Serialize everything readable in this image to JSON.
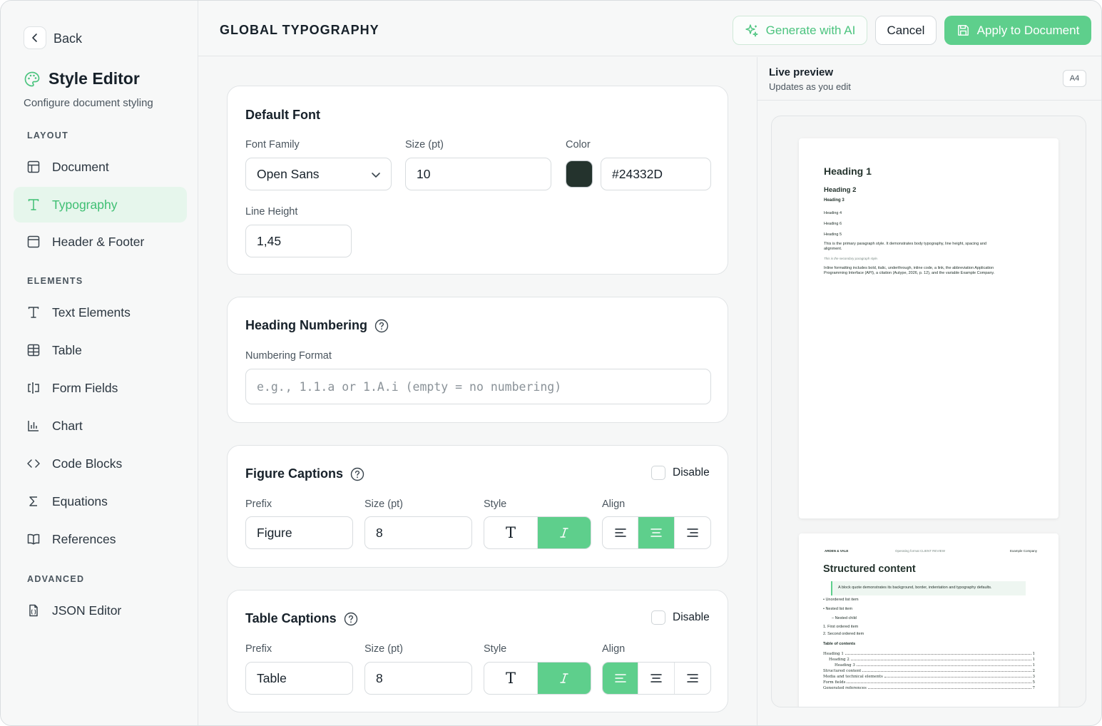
{
  "sidebar": {
    "back_label": "Back",
    "title": "Style Editor",
    "subtitle": "Configure document styling",
    "sections": {
      "layout": "LAYOUT",
      "elements": "ELEMENTS",
      "advanced": "ADVANCED"
    },
    "items": [
      {
        "label": "Document",
        "icon": "layout-icon"
      },
      {
        "label": "Typography",
        "icon": "type-icon",
        "active": true
      },
      {
        "label": "Header & Footer",
        "icon": "panel-icon"
      },
      {
        "label": "Text Elements",
        "icon": "type-icon"
      },
      {
        "label": "Table",
        "icon": "table-icon"
      },
      {
        "label": "Form Fields",
        "icon": "form-input-icon"
      },
      {
        "label": "Chart",
        "icon": "bar-chart-icon"
      },
      {
        "label": "Code Blocks",
        "icon": "code-icon"
      },
      {
        "label": "Equations",
        "icon": "sigma-icon"
      },
      {
        "label": "References",
        "icon": "book-open-icon"
      },
      {
        "label": "JSON Editor",
        "icon": "file-json-icon"
      }
    ],
    "accent": "#3fbf73"
  },
  "toolbar": {
    "title": "GLOBAL TYPOGRAPHY",
    "generate_label": "Generate with AI",
    "cancel_label": "Cancel",
    "apply_label": "Apply to Document",
    "apply_color": "#5ecf8c"
  },
  "default_font": {
    "title": "Default Font",
    "family_label": "Font Family",
    "family_value": "Open Sans",
    "size_label": "Size (pt)",
    "size_value": "10",
    "color_label": "Color",
    "color_value": "#24332D",
    "line_height_label": "Line Height",
    "line_height_value": "1,45"
  },
  "heading_numbering": {
    "title": "Heading Numbering",
    "format_label": "Numbering Format",
    "format_placeholder": "e.g., 1.1.a or 1.A.i (empty = no numbering)"
  },
  "figure_captions": {
    "title": "Figure Captions",
    "disable_label": "Disable",
    "prefix_label": "Prefix",
    "prefix_value": "Figure",
    "size_label": "Size (pt)",
    "size_value": "8",
    "style_label": "Style",
    "style_selected": "italic",
    "align_label": "Align",
    "align_selected": "center"
  },
  "table_captions": {
    "title": "Table Captions",
    "disable_label": "Disable",
    "prefix_label": "Prefix",
    "prefix_value": "Table",
    "size_label": "Size (pt)",
    "size_value": "8",
    "style_label": "Style",
    "style_selected": "italic",
    "align_label": "Align",
    "align_selected": "left"
  },
  "preview": {
    "title": "Live preview",
    "subtitle": "Updates as you edit",
    "page_size": "A4",
    "page1": {
      "h1": "Heading 1",
      "h2": "Heading 2",
      "h3": "Heading 3",
      "h4": "Heading 4",
      "h6": "Heading 6",
      "h5": "Heading 5",
      "para1": "This is the primary paragraph style. It demonstrates body typography, line height, spacing and",
      "para1b": "alignment.",
      "para2": "This is the secondary paragraph style.",
      "para3": "Inline formatting includes bold, italic, underthrough, inline code, a link, the abbreviation Application",
      "para3b": "Programming Interface (API), a citation (Autype, 2026, p. 12), and the variable Example Company."
    },
    "page2": {
      "header_left": "ARDEN & VALE",
      "header_center": "Operating format CLIENT REVIEW",
      "header_right": "Example Company",
      "title": "Structured content",
      "quote": "A block quote demonstrates its background, border, indentation and typography defaults.",
      "list": [
        "• Unordered list item",
        "• Nested list item",
        "– Nested child",
        "1. First ordered item",
        "2. Second ordered item"
      ],
      "toc_title": "Table of contents",
      "toc": [
        {
          "label": "Heading 1",
          "page": "1",
          "indent": 0
        },
        {
          "label": "Heading 2",
          "page": "1",
          "indent": 1
        },
        {
          "label": "Heading 3",
          "page": "1",
          "indent": 2
        },
        {
          "label": "Structured content",
          "page": "2",
          "indent": 0
        },
        {
          "label": "Media and technical elements",
          "page": "3",
          "indent": 0
        },
        {
          "label": "Form fields",
          "page": "5",
          "indent": 0
        },
        {
          "label": "Generated references",
          "page": "7",
          "indent": 0
        }
      ]
    }
  }
}
